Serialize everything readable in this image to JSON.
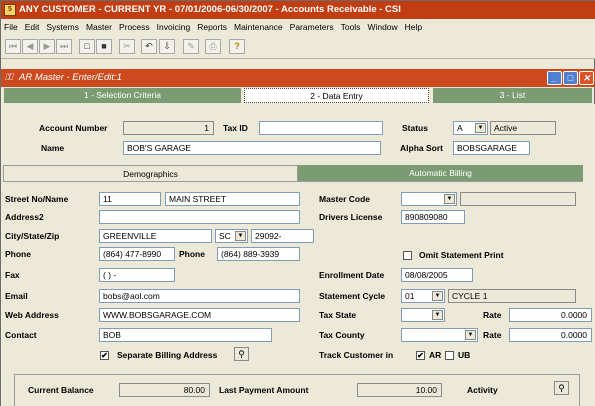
{
  "window": {
    "title": "ANY CUSTOMER - CURRENT YR - 07/01/2006-06/30/2007 - Accounts Receivable - CSI",
    "app_icon": "5"
  },
  "menu": [
    "File",
    "Edit",
    "Systems",
    "Master",
    "Process",
    "Invoicing",
    "Reports",
    "Maintenance",
    "Parameters",
    "Tools",
    "Window",
    "Help"
  ],
  "toolbar": {
    "icons": [
      "first-record-icon",
      "prev-record-icon",
      "next-record-icon",
      "last-record-icon",
      "new-icon",
      "save-icon",
      "delete-icon",
      "undo-icon",
      "import-icon",
      "edit-icon",
      "print-icon",
      "help-icon"
    ]
  },
  "inner_window": {
    "title": "AR Master - Enter/Edit:1"
  },
  "tabs": [
    {
      "label": "1 - Selection Criteria"
    },
    {
      "label": "2 - Data Entry"
    },
    {
      "label": "3 - List"
    }
  ],
  "header": {
    "account_number_label": "Account Number",
    "account_number": "1",
    "tax_id_label": "Tax ID",
    "tax_id": "",
    "status_label": "Status",
    "status_code": "A",
    "status_text": "Active",
    "name_label": "Name",
    "name": "BOB'S GARAGE",
    "alpha_sort_label": "Alpha Sort",
    "alpha_sort": "BOBSGARAGE"
  },
  "subtabs": {
    "demographics": "Demographics",
    "automatic_billing": "Automatic Billing"
  },
  "demographics": {
    "street_label": "Street No/Name",
    "street_no": "11",
    "street_name": "MAIN STREET",
    "address2_label": "Address2",
    "address2": "",
    "city_label": "City/State/Zip",
    "city": "GREENVILLE",
    "state": "SC",
    "zip": "29092-",
    "phone_label": "Phone",
    "phone": "(864) 477-8990",
    "phone2_label": "Phone",
    "phone2": "(864) 889-3939",
    "fax_label": "Fax",
    "fax": "(  )  -",
    "email_label": "Email",
    "email": "bobs@aol.com",
    "web_label": "Web Address",
    "web": "WWW.BOBSGARAGE.COM",
    "contact_label": "Contact",
    "contact": "BOB",
    "separate_billing_label": "Separate Billing Address",
    "separate_billing_checked": "✔"
  },
  "right": {
    "master_code_label": "Master Code",
    "master_code": "",
    "drivers_license_label": "Drivers License",
    "drivers_license": "890809080",
    "omit_statement_label": "Omit Statement Print",
    "enrollment_label": "Enrollment Date",
    "enrollment_date": "08/08/2005",
    "statement_cycle_label": "Statement Cycle",
    "statement_cycle_code": "01",
    "statement_cycle_text": "CYCLE 1",
    "tax_state_label": "Tax State",
    "tax_state_rate_label": "Rate",
    "tax_state_rate": "0.0000",
    "tax_county_label": "Tax County",
    "tax_county_rate_label": "Rate",
    "tax_county_rate": "0.0000",
    "track_customer_label": "Track Customer in",
    "track_ar_checked": "✔",
    "track_ar_label": "AR",
    "track_ub_label": "UB"
  },
  "balance": {
    "current_balance_label": "Current Balance",
    "current_balance": "80.00",
    "last_payment_label": "Last Payment Amount",
    "last_payment": "10.00",
    "activity_label": "Activity"
  }
}
